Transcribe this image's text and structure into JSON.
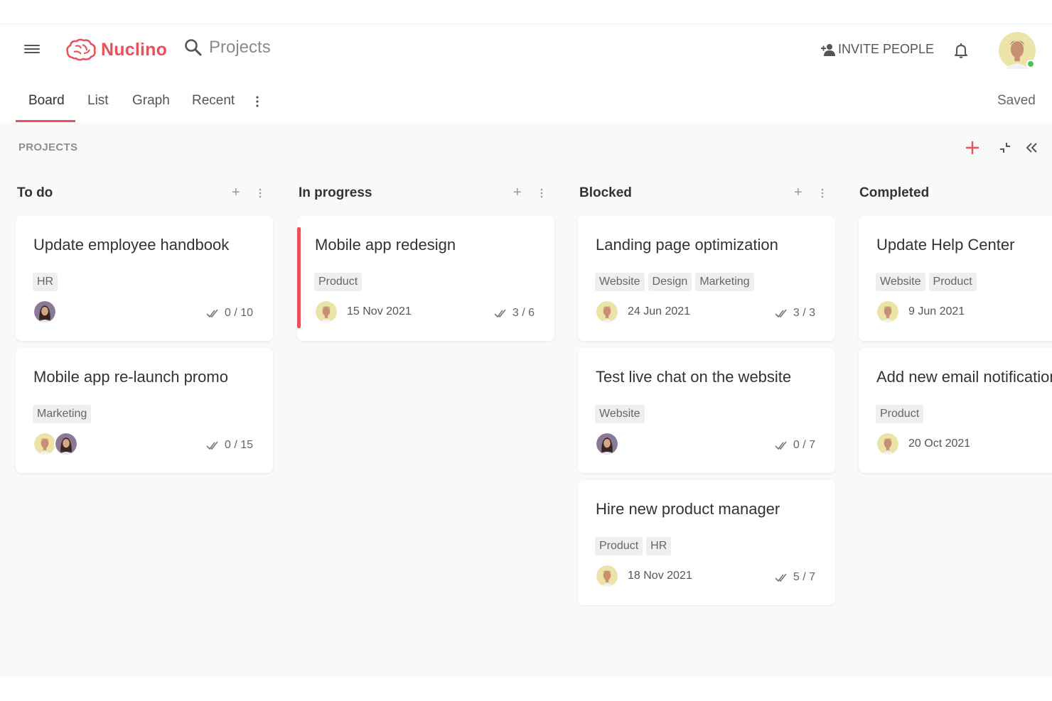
{
  "app": {
    "name": "Nuclino",
    "brand_color": "#e8505b"
  },
  "header": {
    "search_placeholder": "Projects",
    "invite_label": "INVITE PEOPLE"
  },
  "tabs": [
    {
      "label": "Board",
      "active": true
    },
    {
      "label": "List"
    },
    {
      "label": "Graph"
    },
    {
      "label": "Recent"
    }
  ],
  "status": "Saved",
  "board": {
    "title": "PROJECTS",
    "columns": [
      {
        "title": "To do",
        "cards": [
          {
            "title": "Update employee handbook",
            "tags": [
              "HR"
            ],
            "assignees": [
              "woman"
            ],
            "checklist": "0 / 10"
          },
          {
            "title": "Mobile app re-launch promo",
            "tags": [
              "Marketing"
            ],
            "assignees": [
              "man",
              "woman"
            ],
            "checklist": "0 / 15"
          }
        ]
      },
      {
        "title": "In progress",
        "cards": [
          {
            "title": "Mobile app redesign",
            "tags": [
              "Product"
            ],
            "assignees": [
              "man"
            ],
            "due": "15 Nov 2021",
            "checklist": "3 / 6",
            "highlight": true
          }
        ]
      },
      {
        "title": "Blocked",
        "cards": [
          {
            "title": "Landing page optimization",
            "tags": [
              "Website",
              "Design",
              "Marketing"
            ],
            "assignees": [
              "man"
            ],
            "due": "24 Jun 2021",
            "checklist": "3 / 3"
          },
          {
            "title": "Test live chat on the website",
            "tags": [
              "Website"
            ],
            "assignees": [
              "woman"
            ],
            "checklist": "0 / 7"
          },
          {
            "title": "Hire new product manager",
            "tags": [
              "Product",
              "HR"
            ],
            "assignees": [
              "man"
            ],
            "due": "18 Nov 2021",
            "checklist": "5 / 7"
          }
        ]
      },
      {
        "title": "Completed",
        "cards": [
          {
            "title": "Update Help Center",
            "tags": [
              "Website",
              "Product"
            ],
            "assignees": [
              "man"
            ],
            "due": "9 Jun 2021"
          },
          {
            "title": "Add new email notifications",
            "tags": [
              "Product"
            ],
            "assignees": [
              "man"
            ],
            "due": "20 Oct 2021"
          }
        ]
      }
    ]
  },
  "icons": {
    "menu": "hamburger-icon",
    "search": "search-icon",
    "invite": "add-person-icon",
    "notifications": "bell-icon",
    "add": "plus-icon",
    "collapse": "collapse-icon",
    "sidebar_toggle": "double-chevron-left-icon",
    "checklist": "double-check-icon"
  }
}
